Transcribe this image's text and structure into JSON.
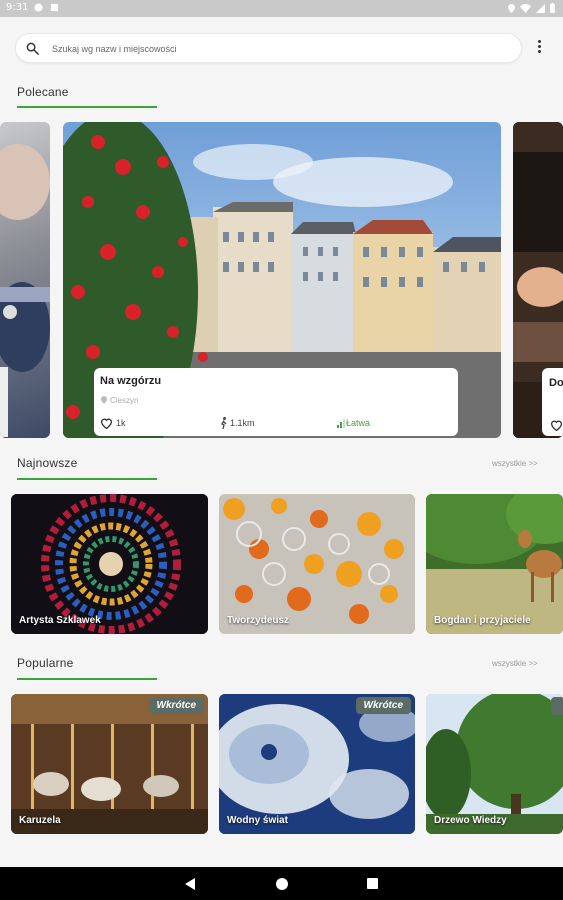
{
  "status_bar": {
    "time": "9:31"
  },
  "search": {
    "placeholder": "Szukaj wg nazw i miejscowości"
  },
  "featured": {
    "title": "Polecane",
    "main_card": {
      "name": "Na wzgórzu",
      "location": "Cieszyn",
      "likes": "1k",
      "distance": "1.1km",
      "difficulty": "Łatwa"
    },
    "right_card": {
      "name_partial": "Do"
    }
  },
  "newest": {
    "title": "Najnowsze",
    "see_all": "wszystkie >>",
    "items": [
      {
        "label": "Artysta Szklawek"
      },
      {
        "label": "Tworzydeusz"
      },
      {
        "label": "Bogdan i przyjaciele"
      }
    ]
  },
  "popular": {
    "title": "Popularne",
    "see_all": "wszystkie >>",
    "items": [
      {
        "label": "Karuzela",
        "badge": "Wkrótce"
      },
      {
        "label": "Wodny świat",
        "badge": "Wkrótce"
      },
      {
        "label": "Drzewo Wiedzy"
      }
    ]
  },
  "colors": {
    "accent": "#3aa53a",
    "badge": "#5d6b66"
  }
}
